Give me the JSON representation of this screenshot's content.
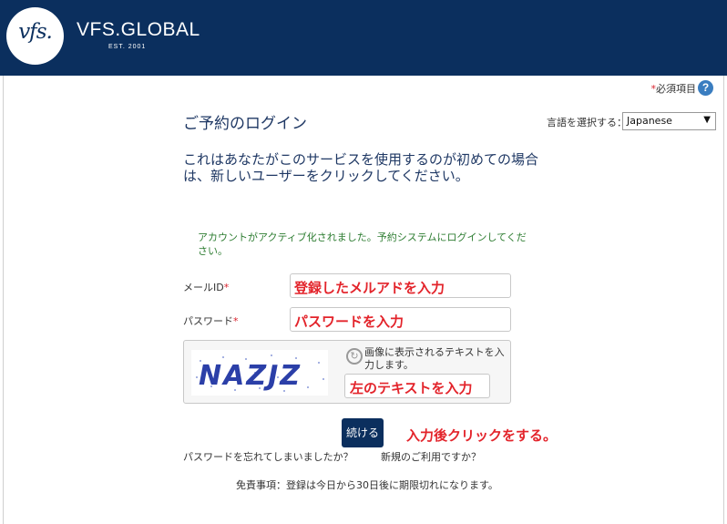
{
  "header": {
    "logo_text": "vfs.",
    "brand": "VFS.GLOBAL",
    "brand_sub": "EST. 2001",
    "bg_color": "#0b2f5e"
  },
  "required_note": "必須項目",
  "required_marker": "*",
  "help_icon_label": "?",
  "page_title": "ご予約のログイン",
  "language": {
    "label": "言語を選択する：",
    "selected": "Japanese"
  },
  "intro_text": "これはあなたがこのサービスを使用するのが初めての場合は、新しいユーザーをクリックしてください。",
  "notice_text": "アカウントがアクティブ化されました。予約システムにログインしてください。",
  "form": {
    "email_label": "メールID",
    "email_value": "登録したメルアドを入力",
    "password_label": "パスワード",
    "password_value": "パスワードを入力"
  },
  "captcha": {
    "text": "NAZJZ",
    "hint": "画像に表示されるテキストを入力します。",
    "input_value": "左のテキストを入力"
  },
  "submit_label": "続ける",
  "submit_annotation": "入力後クリックをする。",
  "links": {
    "forgot_password": "パスワードを忘れてしまいましたか？",
    "new_user": "新規のご利用ですか？"
  },
  "disclaimer": "免責事項：登録は今日から30日後に期限切れになります。"
}
